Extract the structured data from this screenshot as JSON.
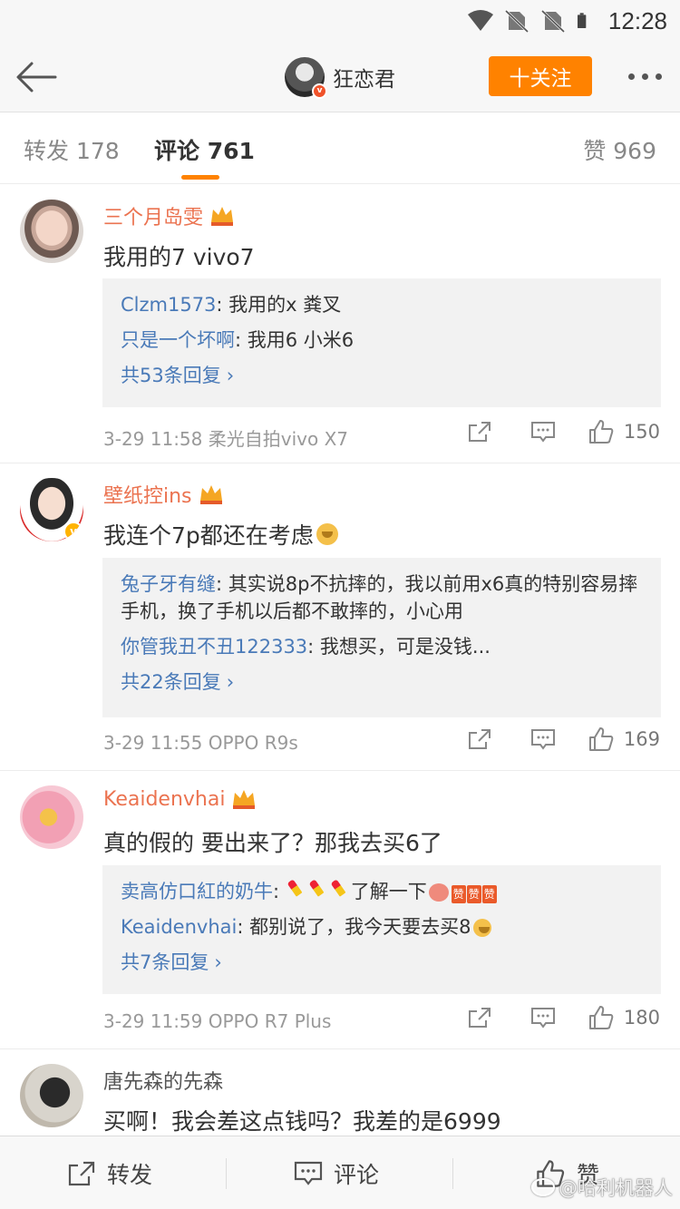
{
  "status_bar": {
    "time": "12:28"
  },
  "nav": {
    "username": "狂恋君",
    "follow_label": "十关注"
  },
  "tabs": [
    {
      "label": "转发",
      "count": "178"
    },
    {
      "label": "评论",
      "count": "761"
    },
    {
      "label": "赞",
      "count": "969"
    }
  ],
  "comments": [
    {
      "name": "三个月岛雯",
      "text": "我用的7 vivo7",
      "replies": [
        {
          "name": "Clzm1573",
          "text": ": 我用的x 粪叉"
        },
        {
          "name": "只是一个坏啊",
          "text": ": 我用6   小米6"
        }
      ],
      "more": "共53条回复",
      "time": "3-29 11:58",
      "device": "柔光自拍vivo X7",
      "likes": "150"
    },
    {
      "name": "壁纸控ins",
      "text": "我连个7p都还在考虑",
      "replies": [
        {
          "name": "兔子牙有缝",
          "text": ": 其实说8p不抗摔的，我以前用x6真的特别容易摔手机，换了手机以后都不敢摔的，小心用"
        },
        {
          "name": "你管我丑不丑122333",
          "text": ": 我想买，可是没钱..."
        }
      ],
      "more": "共22条回复",
      "time": "3-29 11:55",
      "device": "OPPO R9s",
      "likes": "169"
    },
    {
      "name": "Keaidenvhai",
      "text": "真的假的 要出来了？那我去买6了",
      "replies": [
        {
          "name": "卖高仿口紅的奶牛",
          "text": ": ",
          "suffix": "了解一下",
          "zan": [
            "赞",
            "赞",
            "赞"
          ]
        },
        {
          "name": "Keaidenvhai",
          "text": ": 都别说了，我今天要去买8"
        }
      ],
      "more": "共7条回复",
      "time": "3-29 11:59",
      "device": "OPPO R7 Plus",
      "likes": "180"
    },
    {
      "name": "唐先森的先森",
      "text": "买啊！我会差这点钱吗？我差的是6999"
    }
  ],
  "bottom_bar": {
    "repost": "转发",
    "comment": "评论",
    "like": "赞"
  },
  "watermark": "@哈利机器人",
  "colors": {
    "accent": "#ff8200",
    "link": "#4a7ab8",
    "name": "#eb7350"
  }
}
